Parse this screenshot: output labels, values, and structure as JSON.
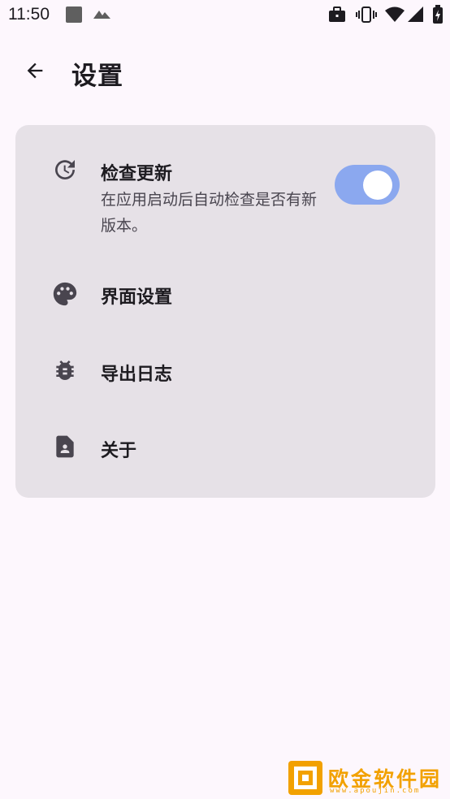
{
  "status_bar": {
    "time": "11:50",
    "left_icons": [
      "app-notification-icon",
      "signal-app-icon"
    ],
    "right_icons": [
      "briefcase-icon",
      "vibrate-icon",
      "wifi-icon",
      "cell-signal-icon",
      "battery-charging-icon"
    ]
  },
  "app_bar": {
    "back_icon": "arrow-back-icon",
    "title": "设置"
  },
  "settings": {
    "items": [
      {
        "icon": "update-history-icon",
        "title": "检查更新",
        "description": "在应用启动后自动检查是否有新版本。",
        "toggle": true,
        "toggle_on": true
      },
      {
        "icon": "palette-icon",
        "title": "界面设置"
      },
      {
        "icon": "bug-icon",
        "title": "导出日志"
      },
      {
        "icon": "contact-page-icon",
        "title": "关于"
      }
    ]
  },
  "colors": {
    "background": "#fdf7fd",
    "card": "#e6e1e7",
    "switch_track_on": "#8ba8ef",
    "text_primary": "#1d1b20",
    "text_secondary": "#49454f"
  },
  "watermark": {
    "text": "欧金软件园",
    "url": "www.apoujin.com"
  }
}
